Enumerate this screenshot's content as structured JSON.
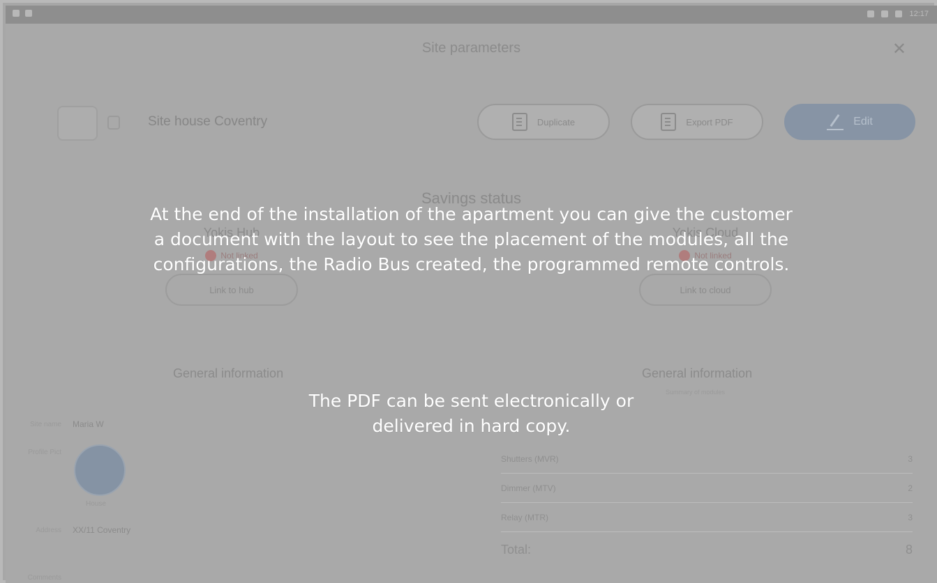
{
  "status_bar": {
    "left_icons": [
      "gallery-icon",
      "photo-icon"
    ],
    "right_text": "12:17"
  },
  "dialog": {
    "title": "Site parameters",
    "close_icon": "close-icon"
  },
  "site": {
    "name": "Site house Coventry"
  },
  "actions": {
    "duplicate": "Duplicate",
    "export_pdf": "Export PDF",
    "edit": "Edit"
  },
  "savings": {
    "title": "Savings status",
    "hub": {
      "title": "Yokis Hub",
      "status": "Not linked",
      "button": "Link to hub"
    },
    "cloud": {
      "title": "Yokis Cloud",
      "status": "Not linked",
      "button": "Link to cloud"
    }
  },
  "general_left": {
    "title": "General information",
    "name_label": "Site name",
    "name_value": "Maria W",
    "type_label": "Profile Pict",
    "avatar_caption": "House",
    "address_label": "Address",
    "address_value": "XX/11 Coventry",
    "comments_label": "Comments"
  },
  "general_right": {
    "title": "General information",
    "subtitle": "Summary of modules",
    "rows": [
      {
        "label": "Shutters (MVR)",
        "value": "3"
      },
      {
        "label": "Dimmer (MTV)",
        "value": "2"
      },
      {
        "label": "Relay (MTR)",
        "value": "3"
      }
    ],
    "total_label": "Total:",
    "total_value": "8"
  },
  "overlay": {
    "paragraph1": "At the end of the installation of the apartment you can give the customer a document with the layout to see the placement of the modules, all the configurations, the Radio Bus created, the programmed remote controls.",
    "paragraph2": "The PDF can be sent electronically or delivered in hard copy."
  },
  "colors": {
    "edit_button": "#8794a5",
    "overlay_text": "#ffffff",
    "dim_background": "#a9a9a9"
  }
}
